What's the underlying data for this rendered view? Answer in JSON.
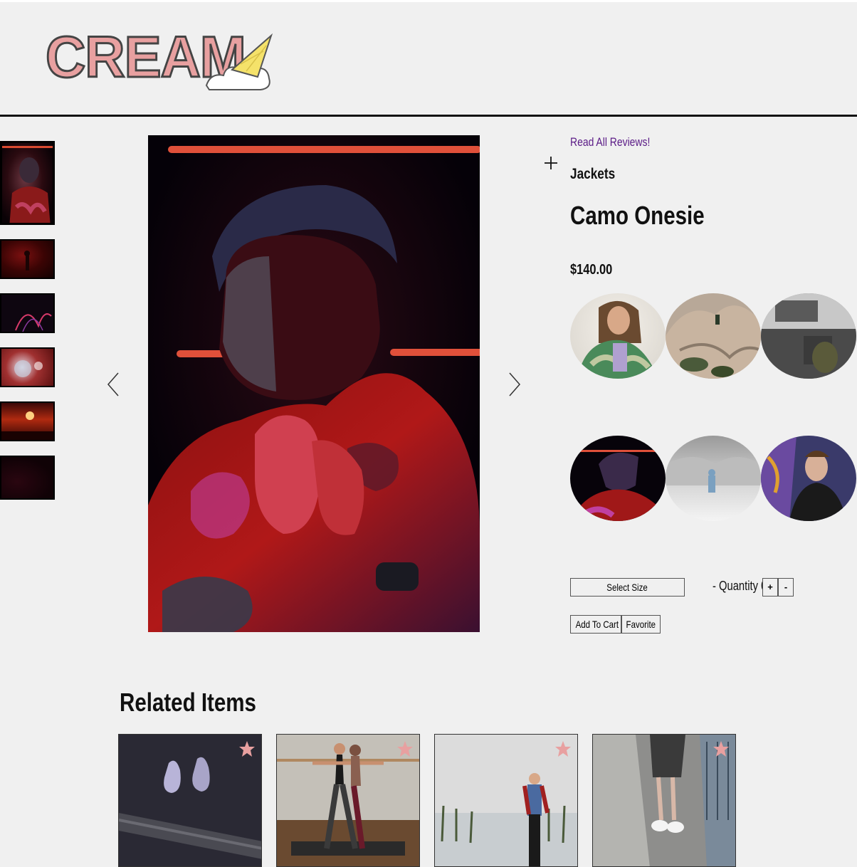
{
  "header": {
    "logo_text": "CREAM"
  },
  "thumbnails": [
    {
      "name": "thumb-1",
      "bg": "#1a0608"
    },
    {
      "name": "thumb-2",
      "bg": "#3a0606"
    },
    {
      "name": "thumb-3",
      "bg": "#120612"
    },
    {
      "name": "thumb-4",
      "bg": "#7a1a1a"
    },
    {
      "name": "thumb-5",
      "bg": "#5a0a08"
    },
    {
      "name": "thumb-6",
      "bg": "#120306"
    }
  ],
  "product": {
    "reviews_link": "Read All Reviews!",
    "category": "Jackets",
    "name": "Camo Onesie",
    "price": "$140.00"
  },
  "controls": {
    "select_size": "Select Size",
    "quantity_label": "- Quantity 0",
    "plus": "+",
    "minus": "-",
    "add_to_cart": "Add To Cart",
    "favorite": "Favorite"
  },
  "related": {
    "title": "Related Items",
    "star_color": "#e8a0a0"
  },
  "colors": {
    "background": "#f0f0f0",
    "reviews_link": "#5a1a86",
    "logo_fill": "#e8a0a0",
    "accent_red": "#d02828"
  }
}
